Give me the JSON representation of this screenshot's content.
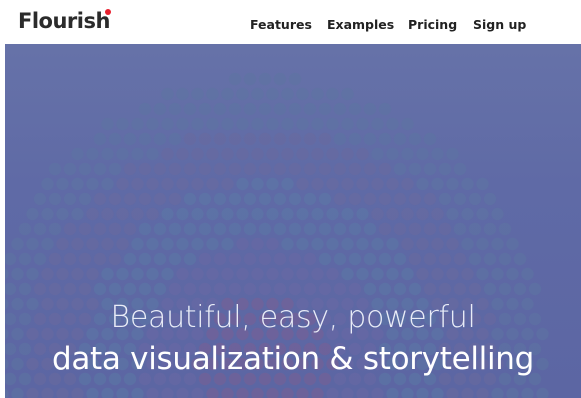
{
  "header": {
    "logo_text": "Flourish",
    "logo_dot_color": "#e8202e",
    "nav": [
      {
        "label": "Features"
      },
      {
        "label": "Examples"
      },
      {
        "label": "Pricing"
      },
      {
        "label": "Sign up"
      }
    ]
  },
  "hero": {
    "headline": "Beautiful, easy, powerful",
    "subheadline": "data visualization & storytelling",
    "background_color": "#6470a8"
  }
}
